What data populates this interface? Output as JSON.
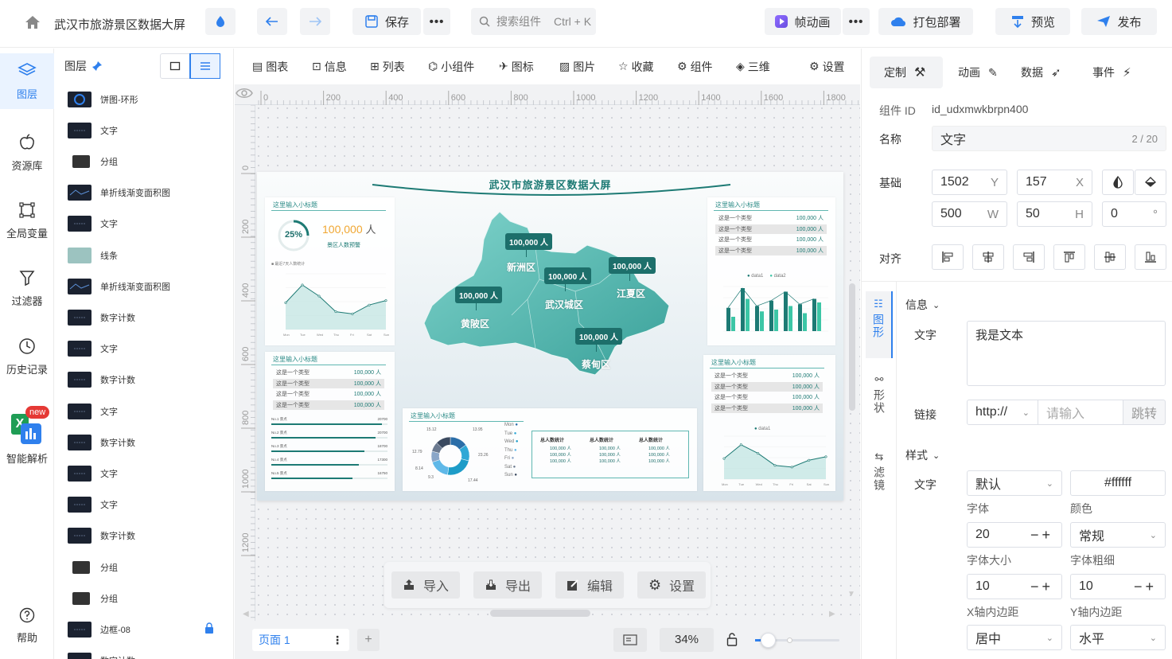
{
  "app": {
    "title": "武汉市旅游景区数据大屏",
    "save_label": "保存",
    "search_placeholder": "搜索组件",
    "search_shortcut": "Ctrl + K",
    "frame_anim_label": "帧动画",
    "package_label": "打包部署",
    "preview_label": "预览",
    "publish_label": "发布"
  },
  "leftnav": {
    "items": [
      {
        "label": "图层",
        "icon": "layers-icon",
        "active": true
      },
      {
        "label": "资源库",
        "icon": "apple-icon"
      },
      {
        "label": "全局变量",
        "icon": "frame-icon"
      },
      {
        "label": "过滤器",
        "icon": "filter-icon"
      },
      {
        "label": "历史记录",
        "icon": "clock-icon"
      },
      {
        "label": "智能解析",
        "icon": "excel-icon",
        "badge": "new"
      },
      {
        "label": "帮助",
        "icon": "help-icon"
      }
    ]
  },
  "layers_panel": {
    "title": "图层",
    "items": [
      {
        "label": "饼图-环形",
        "thumb": "donut"
      },
      {
        "label": "文字",
        "thumb": "text"
      },
      {
        "label": "分组",
        "thumb": "folder"
      },
      {
        "label": "单折线渐变面积图",
        "thumb": "line"
      },
      {
        "label": "文字",
        "thumb": "text"
      },
      {
        "label": "线条",
        "thumb": "bar"
      },
      {
        "label": "单折线渐变面积图",
        "thumb": "line"
      },
      {
        "label": "数字计数",
        "thumb": "num"
      },
      {
        "label": "文字",
        "thumb": "text"
      },
      {
        "label": "数字计数",
        "thumb": "num"
      },
      {
        "label": "文字",
        "thumb": "text"
      },
      {
        "label": "数字计数",
        "thumb": "num"
      },
      {
        "label": "文字",
        "thumb": "text"
      },
      {
        "label": "文字",
        "thumb": "text"
      },
      {
        "label": "数字计数",
        "thumb": "num"
      },
      {
        "label": "分组",
        "thumb": "folder"
      },
      {
        "label": "分组",
        "thumb": "folder"
      },
      {
        "label": "边框-08",
        "thumb": "text",
        "locked": true
      },
      {
        "label": "数字计数",
        "thumb": "num"
      }
    ]
  },
  "toolbar": {
    "items": [
      "图表",
      "信息",
      "列表",
      "小组件",
      "图标",
      "图片",
      "收藏",
      "组件",
      "三维"
    ],
    "settings_label": "设置"
  },
  "ruler": {
    "h_ticks": [
      "0",
      "200",
      "400",
      "600",
      "800",
      "1000",
      "1200",
      "1400",
      "1600",
      "1800"
    ],
    "v_ticks": [
      "0",
      "200",
      "400",
      "600",
      "800",
      "1000",
      "1200"
    ]
  },
  "dashboard": {
    "title": "武汉市旅游景区数据大屏",
    "subtitle": "这里输入小标题",
    "kpi_percent": "25%",
    "kpi_value": "100,000",
    "kpi_unit": "人",
    "kpi_label": "景区人数预警",
    "chart_legend_small": "最近7天人数统计",
    "row_label": "这是一个类型",
    "row_value": "100,000 人",
    "rank_items": [
      {
        "name": "No.1 景点",
        "value": "20700"
      },
      {
        "name": "No.2 景点",
        "value": "20700"
      },
      {
        "name": "No.3 景点",
        "value": "18700"
      },
      {
        "name": "No.4 景点",
        "value": "17300"
      },
      {
        "name": "No.5 景点",
        "value": "16750"
      }
    ],
    "map_areas": [
      {
        "name": "新洲区",
        "value": "100,000 人"
      },
      {
        "name": "武汉城区",
        "value": "100,000 人"
      },
      {
        "name": "江夏区",
        "value": "100,000 人"
      },
      {
        "name": "黄陂区",
        "value": "100,000 人"
      },
      {
        "name": "蔡甸区",
        "value": "100,000 人"
      }
    ],
    "bar_legend": [
      "data1",
      "data2"
    ],
    "area_legend": "data1",
    "donut_labels": [
      "15.12",
      "13.95",
      "12.79",
      "23.26",
      "8.14",
      "9.3",
      "17.44"
    ],
    "days": [
      "Mon",
      "Tue",
      "Wed",
      "Thu",
      "Fri",
      "Sat",
      "Sun"
    ],
    "stat_title": "总人数统计",
    "stat_value": "100,000 人"
  },
  "canvas_actions": {
    "import_label": "导入",
    "export_label": "导出",
    "edit_label": "编辑",
    "settings_label": "设置"
  },
  "footer": {
    "page_label": "页面 1",
    "zoom": "34%"
  },
  "right_panel": {
    "tabs": [
      "定制",
      "动画",
      "数据",
      "事件"
    ],
    "component_id_label": "组件 ID",
    "component_id": "id_udxmwkbrpn400",
    "name_label": "名称",
    "name_value": "文字",
    "name_count": "2 / 20",
    "basic_label": "基础",
    "y_value": "1502",
    "x_value": "157",
    "w_value": "500",
    "h_value": "50",
    "angle_value": "0",
    "align_label": "对齐",
    "side_tabs": [
      "图形",
      "形状",
      "滤镜"
    ],
    "info_section": "信息",
    "text_label": "文字",
    "text_value": "我是文本",
    "link_label": "链接",
    "link_protocol": "http://",
    "link_placeholder": "请输入",
    "link_jump": "跳转",
    "style_section": "样式",
    "style_text_label": "文字",
    "font_value": "默认",
    "font_label": "字体",
    "color_value": "#ffffff",
    "color_label": "颜色",
    "font_size_value": "20",
    "font_size_label": "字体大小",
    "font_weight_value": "常规",
    "font_weight_label": "字体粗细",
    "padding_x_value": "10",
    "padding_x_label": "X轴内边距",
    "padding_y_value": "10",
    "padding_y_label": "Y轴内边距",
    "h_align_value": "居中",
    "v_align_value": "水平"
  },
  "colors": {
    "accent": "#2f80ed",
    "teal": "#1d7a74",
    "map": "#5fbfb8"
  }
}
